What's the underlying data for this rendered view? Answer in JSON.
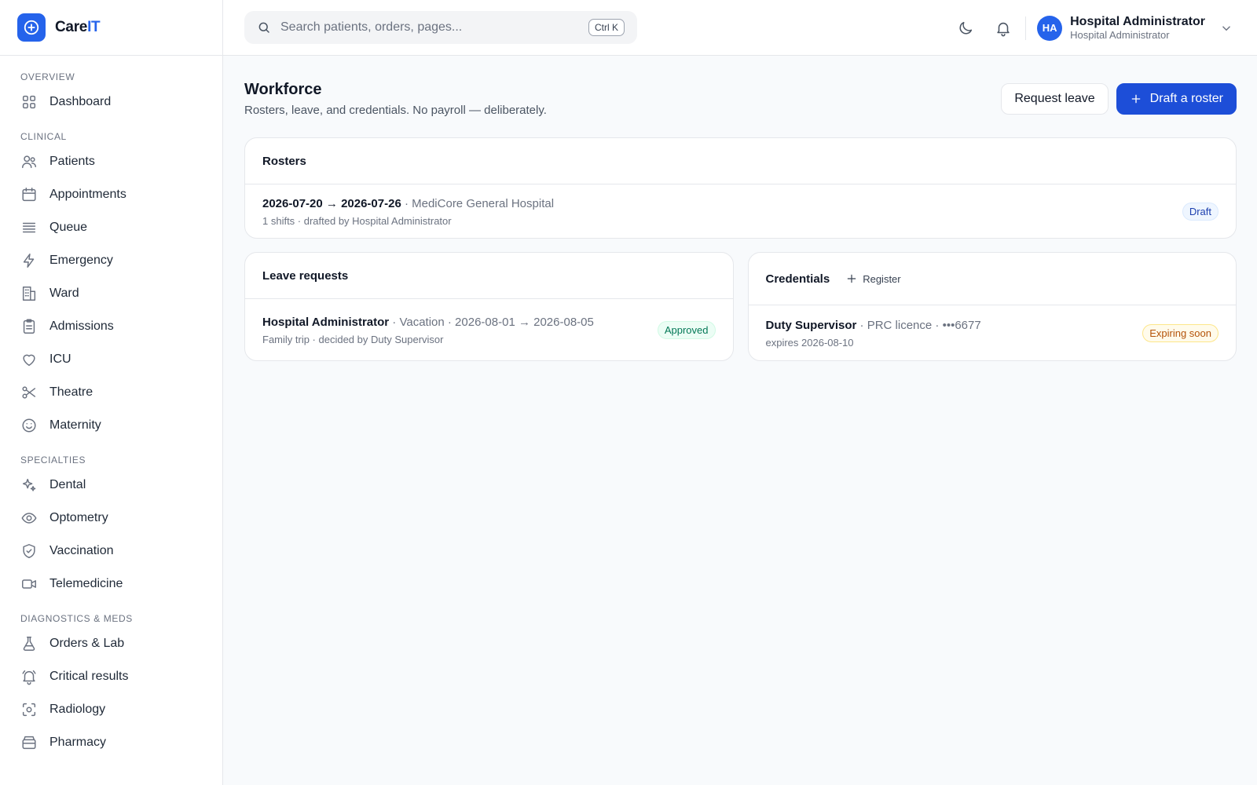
{
  "brand": {
    "name_main": "Care",
    "name_accent": "IT",
    "logo_icon": "plus-circle-icon",
    "accent_color": "#2563eb"
  },
  "sidebar": {
    "sections": [
      {
        "label": "Overview",
        "items": [
          {
            "label": "Dashboard",
            "icon": "grid-icon"
          }
        ]
      },
      {
        "label": "Clinical",
        "items": [
          {
            "label": "Patients",
            "icon": "users-icon"
          },
          {
            "label": "Appointments",
            "icon": "calendar-icon"
          },
          {
            "label": "Queue",
            "icon": "list-icon"
          },
          {
            "label": "Emergency",
            "icon": "lightning-icon"
          },
          {
            "label": "Ward",
            "icon": "building-icon"
          },
          {
            "label": "Admissions",
            "icon": "clipboard-icon"
          },
          {
            "label": "ICU",
            "icon": "heart-icon"
          },
          {
            "label": "Theatre",
            "icon": "scissors-icon"
          },
          {
            "label": "Maternity",
            "icon": "smile-icon"
          }
        ]
      },
      {
        "label": "Specialties",
        "items": [
          {
            "label": "Dental",
            "icon": "sparkles-icon"
          },
          {
            "label": "Optometry",
            "icon": "eye-icon"
          },
          {
            "label": "Vaccination",
            "icon": "shield-check-icon"
          },
          {
            "label": "Telemedicine",
            "icon": "video-icon"
          }
        ]
      },
      {
        "label": "Diagnostics & Meds",
        "items": [
          {
            "label": "Orders & Lab",
            "icon": "flask-icon"
          },
          {
            "label": "Critical results",
            "icon": "alert-bell-icon"
          },
          {
            "label": "Radiology",
            "icon": "scan-icon"
          },
          {
            "label": "Pharmacy",
            "icon": "pill-box-icon"
          }
        ]
      }
    ]
  },
  "header": {
    "search_placeholder": "Search patients, orders, pages...",
    "search_shortcut": "Ctrl K",
    "user": {
      "initials": "HA",
      "name": "Hospital Administrator",
      "role": "Hospital Administrator"
    }
  },
  "page": {
    "title": "Workforce",
    "subtitle": "Rosters, leave, and credentials. No payroll — deliberately.",
    "request_leave_label": "Request leave",
    "draft_roster_label": "Draft a roster"
  },
  "rosters": {
    "title": "Rosters",
    "row": {
      "period": "2026-07-20 → 2026-07-26",
      "location": " · MediCore General Hospital",
      "meta": "1 shifts · drafted by Hospital Administrator",
      "status": "Draft"
    }
  },
  "leave": {
    "title": "Leave requests",
    "row": {
      "who": "Hospital Administrator",
      "details": " · Vacation · 2026-08-01 → 2026-08-05",
      "meta": "Family trip · decided by Duty Supervisor",
      "status": "Approved"
    }
  },
  "credentials": {
    "title": "Credentials",
    "register_label": "Register",
    "row": {
      "who": "Duty Supervisor",
      "details": " · PRC licence · •••6677",
      "meta": "expires 2026-08-10",
      "status": "Expiring soon"
    }
  }
}
